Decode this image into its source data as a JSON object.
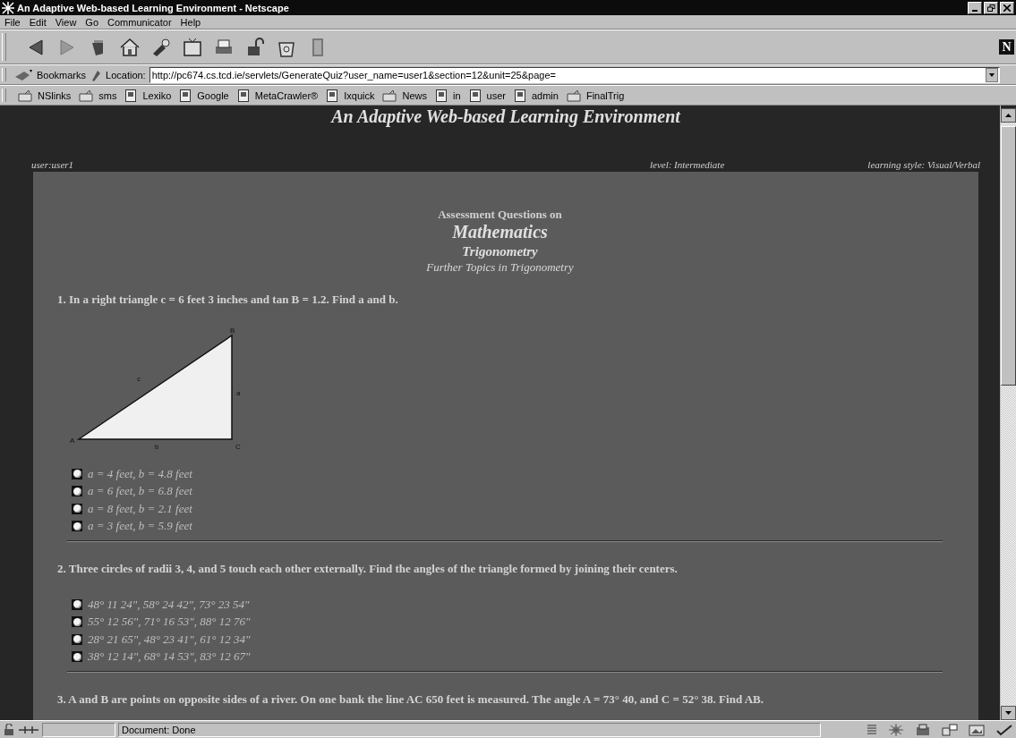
{
  "window": {
    "title": "An Adaptive Web-based Learning Environment - Netscape"
  },
  "menu": [
    "File",
    "Edit",
    "View",
    "Go",
    "Communicator",
    "Help"
  ],
  "brand_mark": "N",
  "location": {
    "bookmarks": "Bookmarks",
    "label": "Location:",
    "url": "http://pc674.cs.tcd.ie/servlets/GenerateQuiz?user_name=user1&section=12&unit=25&page="
  },
  "personal_toolbar": [
    {
      "label": "NSlinks",
      "kind": "folder"
    },
    {
      "label": "sms",
      "kind": "folder"
    },
    {
      "label": "Lexiko",
      "kind": "page"
    },
    {
      "label": "Google",
      "kind": "page"
    },
    {
      "label": "MetaCrawler®",
      "kind": "page"
    },
    {
      "label": "Ixquick",
      "kind": "page"
    },
    {
      "label": "News",
      "kind": "folder"
    },
    {
      "label": "in",
      "kind": "page"
    },
    {
      "label": "user",
      "kind": "page"
    },
    {
      "label": "admin",
      "kind": "page"
    },
    {
      "label": "FinalTrig",
      "kind": "folder"
    }
  ],
  "page": {
    "heading": "An Adaptive Web-based Learning Environment",
    "user": "user:user1",
    "level": "level: Intermediate",
    "learning_style": "learning style: Visual/Verbal",
    "intro": "Assessment Questions on",
    "subject": "Mathematics",
    "section": "Trigonometry",
    "unit": "Further Topics in Trigonometry",
    "questions": [
      {
        "text": "1. In a right triangle c = 6 feet 3 inches and tan B = 1.2. Find a and b.",
        "figure": {
          "labels": [
            "A",
            "B",
            "C",
            "a",
            "b",
            "c"
          ]
        },
        "options": [
          {
            "text": "a = 4 feet, b = 4.8 feet",
            "selected": false
          },
          {
            "text": "a = 6 feet, b = 6.8 feet",
            "selected": false
          },
          {
            "text": "a = 8 feet, b = 2.1 feet",
            "selected": false
          },
          {
            "text": "a = 3 feet, b = 5.9 feet",
            "selected": false
          }
        ]
      },
      {
        "text": "2. Three circles of radii 3, 4, and 5 touch each other externally. Find the angles of the triangle formed by joining their centers.",
        "options": [
          {
            "text": "48° 11 24\", 58° 24 42\", 73° 23 54\"",
            "selected": false
          },
          {
            "text": "55° 12 56\", 71° 16 53\", 88° 12 76\"",
            "selected": false
          },
          {
            "text": "28° 21 65\", 48° 23 41\", 61° 12 34\"",
            "selected": false
          },
          {
            "text": "38° 12 14\", 68° 14 53\", 83° 12 67\"",
            "selected": false
          }
        ]
      },
      {
        "text": "3. A and B are points on opposite sides of a river. On one bank the line AC 650 feet is measured. The angle A = 73° 40, and C = 52° 38. Find AB."
      }
    ]
  },
  "status_bar": {
    "text": "Document: Done"
  }
}
